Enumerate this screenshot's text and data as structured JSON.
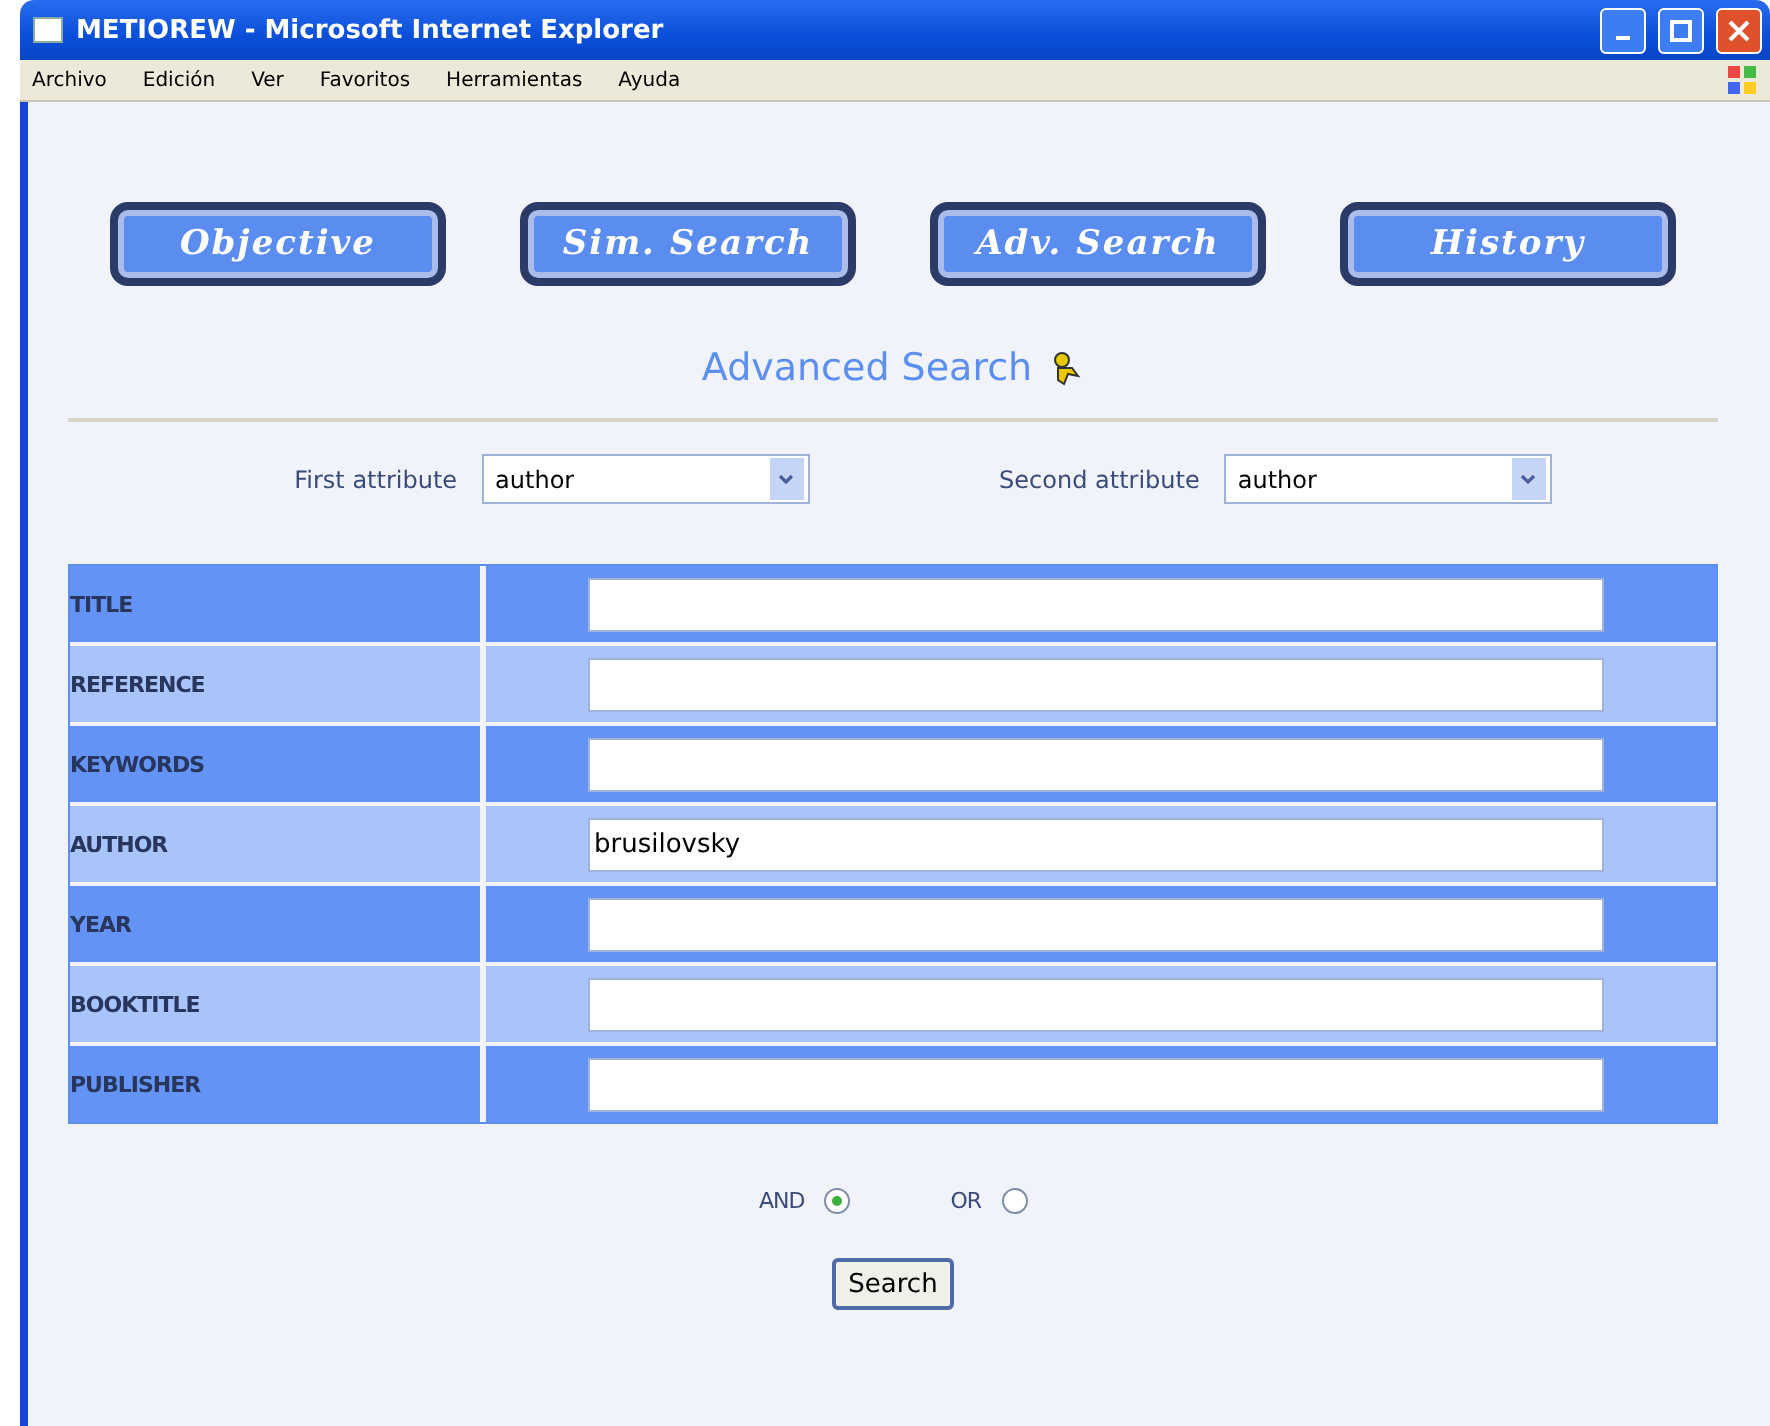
{
  "window": {
    "title": "METIOREW - Microsoft Internet Explorer"
  },
  "menu": [
    "Archivo",
    "Edición",
    "Ver",
    "Favoritos",
    "Herramientas",
    "Ayuda"
  ],
  "nav_buttons": [
    "Objective",
    "Sim. Search",
    "Adv. Search",
    "History"
  ],
  "heading": "Advanced Search",
  "attributes": [
    {
      "label": "First attribute",
      "value": "author"
    },
    {
      "label": "Second attribute",
      "value": "author"
    }
  ],
  "fields": [
    {
      "label": "TITLE"
    },
    {
      "label": "REFERENCE"
    },
    {
      "label": "KEYWORDS"
    },
    {
      "label": "AUTHOR",
      "value": "brusilovsky"
    },
    {
      "label": "YEAR"
    },
    {
      "label": "BOOKTITLE"
    },
    {
      "label": "PUBLISHER"
    }
  ],
  "operators": [
    {
      "label": "AND",
      "selected": true
    },
    {
      "label": "OR",
      "selected": false
    }
  ],
  "submit": "Search"
}
